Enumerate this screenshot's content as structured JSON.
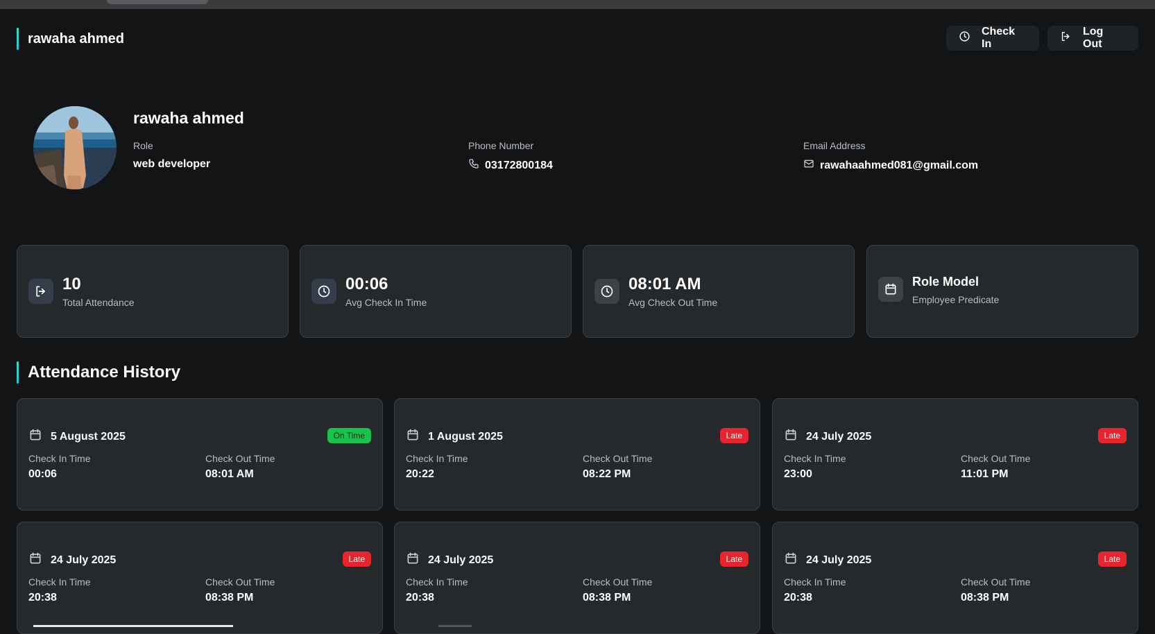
{
  "header": {
    "title": "rawaha ahmed",
    "check_in_label": "Check In",
    "logout_label": "Log Out",
    "accent_color": "#35e0c0"
  },
  "profile": {
    "name": "rawaha ahmed",
    "role_label": "Role",
    "role": "web developer",
    "phone_label": "Phone Number",
    "phone": "03172800184",
    "email_label": "Email Address",
    "email": "rawahaahmed081@gmail.com"
  },
  "stats": [
    {
      "value": "10",
      "label": "Total Attendance",
      "icon": "log-in-icon"
    },
    {
      "value": "00:06",
      "label": "Avg Check In Time",
      "icon": "clock-icon"
    },
    {
      "value": "08:01 AM",
      "label": "Avg Check Out Time",
      "icon": "clock-icon"
    },
    {
      "value": "Role Model",
      "label": "Employee Predicate",
      "icon": "calendar-icon"
    }
  ],
  "history": {
    "title": "Attendance History",
    "check_in_label": "Check In Time",
    "check_out_label": "Check Out Time",
    "records": [
      {
        "date": "5 August 2025",
        "status": "On Time",
        "check_in": "00:06",
        "check_out": "08:01 AM"
      },
      {
        "date": "1 August 2025",
        "status": "Late",
        "check_in": "20:22",
        "check_out": "08:22 PM"
      },
      {
        "date": "24 July 2025",
        "status": "Late",
        "check_in": "23:00",
        "check_out": "11:01 PM"
      },
      {
        "date": "24 July 2025",
        "status": "Late",
        "check_in": "20:38",
        "check_out": "08:38 PM"
      },
      {
        "date": "24 July 2025",
        "status": "Late",
        "check_in": "20:38",
        "check_out": "08:38 PM"
      },
      {
        "date": "24 July 2025",
        "status": "Late",
        "check_in": "20:38",
        "check_out": "08:38 PM"
      }
    ]
  },
  "colors": {
    "background": "#121416",
    "card": "#25292c",
    "late": "#e8252f",
    "on_time": "#19c24f"
  }
}
